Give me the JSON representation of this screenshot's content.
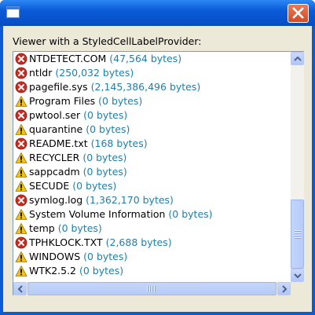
{
  "window": {
    "title": "",
    "close_icon": "close-icon"
  },
  "group_label": "Viewer with a StyledCellLabelProvider:",
  "colors": {
    "size_text": "#1f7fa8",
    "error_icon": "#cc2a1e",
    "warning_icon": "#f2c21b"
  },
  "items": [
    {
      "name": "NTDETECT.COM",
      "size": "(47,564 bytes)",
      "icon": "error-icon"
    },
    {
      "name": "ntldr",
      "size": "(250,032 bytes)",
      "icon": "error-icon"
    },
    {
      "name": "pagefile.sys",
      "size": "(2,145,386,496 bytes)",
      "icon": "error-icon"
    },
    {
      "name": "Program Files",
      "size": "(0 bytes)",
      "icon": "warning-icon"
    },
    {
      "name": "pwtool.ser",
      "size": "(0 bytes)",
      "icon": "error-icon"
    },
    {
      "name": "quarantine",
      "size": "(0 bytes)",
      "icon": "warning-icon"
    },
    {
      "name": "README.txt",
      "size": "(168 bytes)",
      "icon": "error-icon"
    },
    {
      "name": "RECYCLER",
      "size": "(0 bytes)",
      "icon": "warning-icon"
    },
    {
      "name": "sappcadm",
      "size": "(0 bytes)",
      "icon": "warning-icon"
    },
    {
      "name": "SECUDE",
      "size": "(0 bytes)",
      "icon": "warning-icon"
    },
    {
      "name": "symlog.log",
      "size": "(1,362,170 bytes)",
      "icon": "error-icon"
    },
    {
      "name": "System Volume Information",
      "size": "(0 bytes)",
      "icon": "warning-icon"
    },
    {
      "name": "temp",
      "size": "(0 bytes)",
      "icon": "warning-icon"
    },
    {
      "name": "TPHKLOCK.TXT",
      "size": "(2,688 bytes)",
      "icon": "error-icon"
    },
    {
      "name": "WINDOWS",
      "size": "(0 bytes)",
      "icon": "warning-icon"
    },
    {
      "name": "WTK2.5.2",
      "size": "(0 bytes)",
      "icon": "warning-icon"
    }
  ],
  "scrollbars": {
    "vertical_position": 0.85,
    "horizontal_position": 0.0
  }
}
